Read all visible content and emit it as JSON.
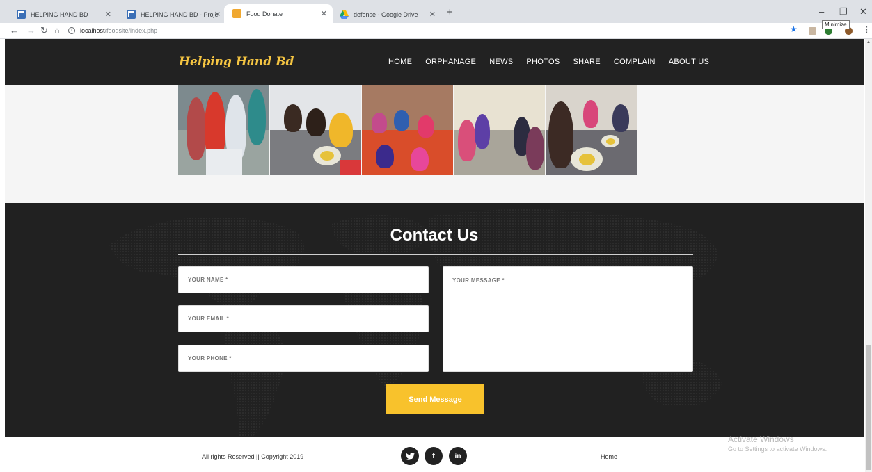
{
  "browser": {
    "tabs": [
      {
        "title": "HELPING HAND BD",
        "icon": "grid-favicon-icon",
        "active": false
      },
      {
        "title": "HELPING HAND BD - Project Det",
        "icon": "grid-favicon-icon",
        "active": false
      },
      {
        "title": "Food Donate",
        "icon": "food-favicon-icon",
        "active": true
      },
      {
        "title": "defense - Google Drive",
        "icon": "google-drive-icon",
        "active": false
      }
    ],
    "url_host": "localhost",
    "url_path": "/foodsite/index.php",
    "tooltip": "Minimize"
  },
  "site": {
    "logo": "Helping Hand Bd",
    "nav": [
      "HOME",
      "ORPHANAGE",
      "NEWS",
      "PHOTOS",
      "SHARE",
      "COMPLAIN",
      "ABOUT US"
    ]
  },
  "contact": {
    "title": "Contact Us",
    "name_placeholder": "YOUR NAME *",
    "email_placeholder": "YOUR EMAIL *",
    "phone_placeholder": "YOUR PHONE *",
    "message_placeholder": "YOUR MESSAGE *",
    "send_label": "Send Message"
  },
  "footer": {
    "copyright": "All rights Reserved || Copyright 2019",
    "social": [
      "twitter-icon",
      "facebook-icon",
      "linkedin-icon"
    ],
    "link": "Home"
  },
  "os": {
    "activate_title": "Activate Windows",
    "activate_sub": "Go to Settings to activate Windows."
  },
  "colors": {
    "header_bg": "#222222",
    "logo": "#f5c542",
    "accent": "#f8c22c",
    "contact_bg": "#212121"
  }
}
